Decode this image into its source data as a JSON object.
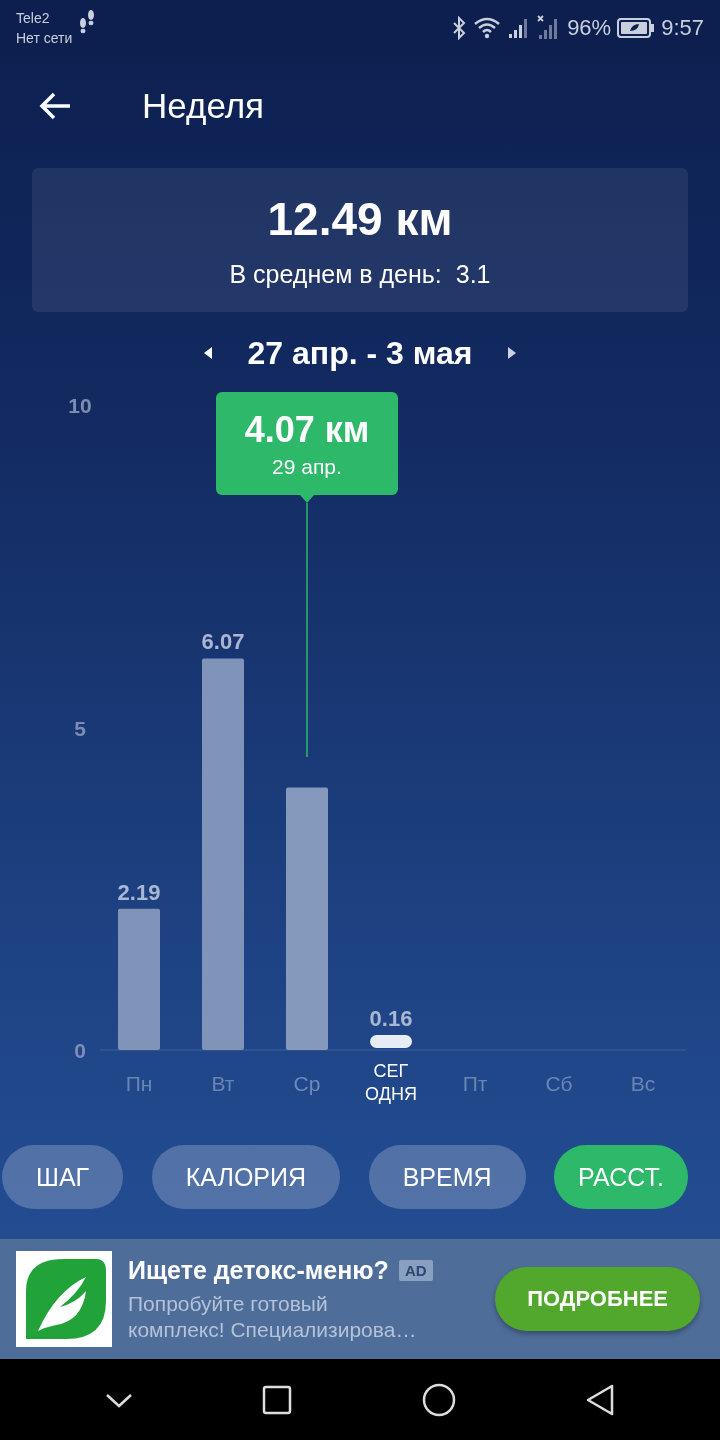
{
  "status_bar": {
    "carrier": "Tele2",
    "network": "Нет сети",
    "battery": "96%",
    "time": "9:57"
  },
  "header": {
    "title": "Неделя"
  },
  "summary": {
    "total": "12.49 км",
    "average_label": "В среднем в день:",
    "average_value": "3.1"
  },
  "period": {
    "label": "27 апр. - 3 мая"
  },
  "chart_section": {
    "chart_data": {
      "type": "bar",
      "categories": [
        "Пн",
        "Вт",
        "Ср",
        "СЕГ ОДНЯ",
        "Пт",
        "Сб",
        "Вс"
      ],
      "values": [
        2.19,
        6.07,
        4.07,
        0.16,
        null,
        null,
        null
      ],
      "ylim": [
        0,
        10
      ],
      "yticks": [
        0,
        5,
        10
      ],
      "value_labels": [
        "2.19",
        "6.07",
        null,
        "0.16",
        null,
        null,
        null
      ]
    },
    "bars": [
      {
        "today": false
      },
      {
        "today": false
      },
      {
        "today": false,
        "tooltip": {
          "value": "4.07 км",
          "date": "29 апр."
        }
      },
      {
        "today": true
      },
      {
        "today": false
      },
      {
        "today": false
      },
      {
        "today": false
      }
    ]
  },
  "metric_tabs": [
    {
      "label": "ШАГ",
      "selected": false
    },
    {
      "label": "КАЛОРИЯ",
      "selected": false
    },
    {
      "label": "ВРЕМЯ",
      "selected": false
    },
    {
      "label": "РАССТ.",
      "selected": true
    }
  ],
  "ad": {
    "title": "Ищете детокс-меню?",
    "badge": "AD",
    "text": "Попробуйте готовый комплекс! Специализирова…",
    "button": "ПОДРОБНЕЕ"
  }
}
